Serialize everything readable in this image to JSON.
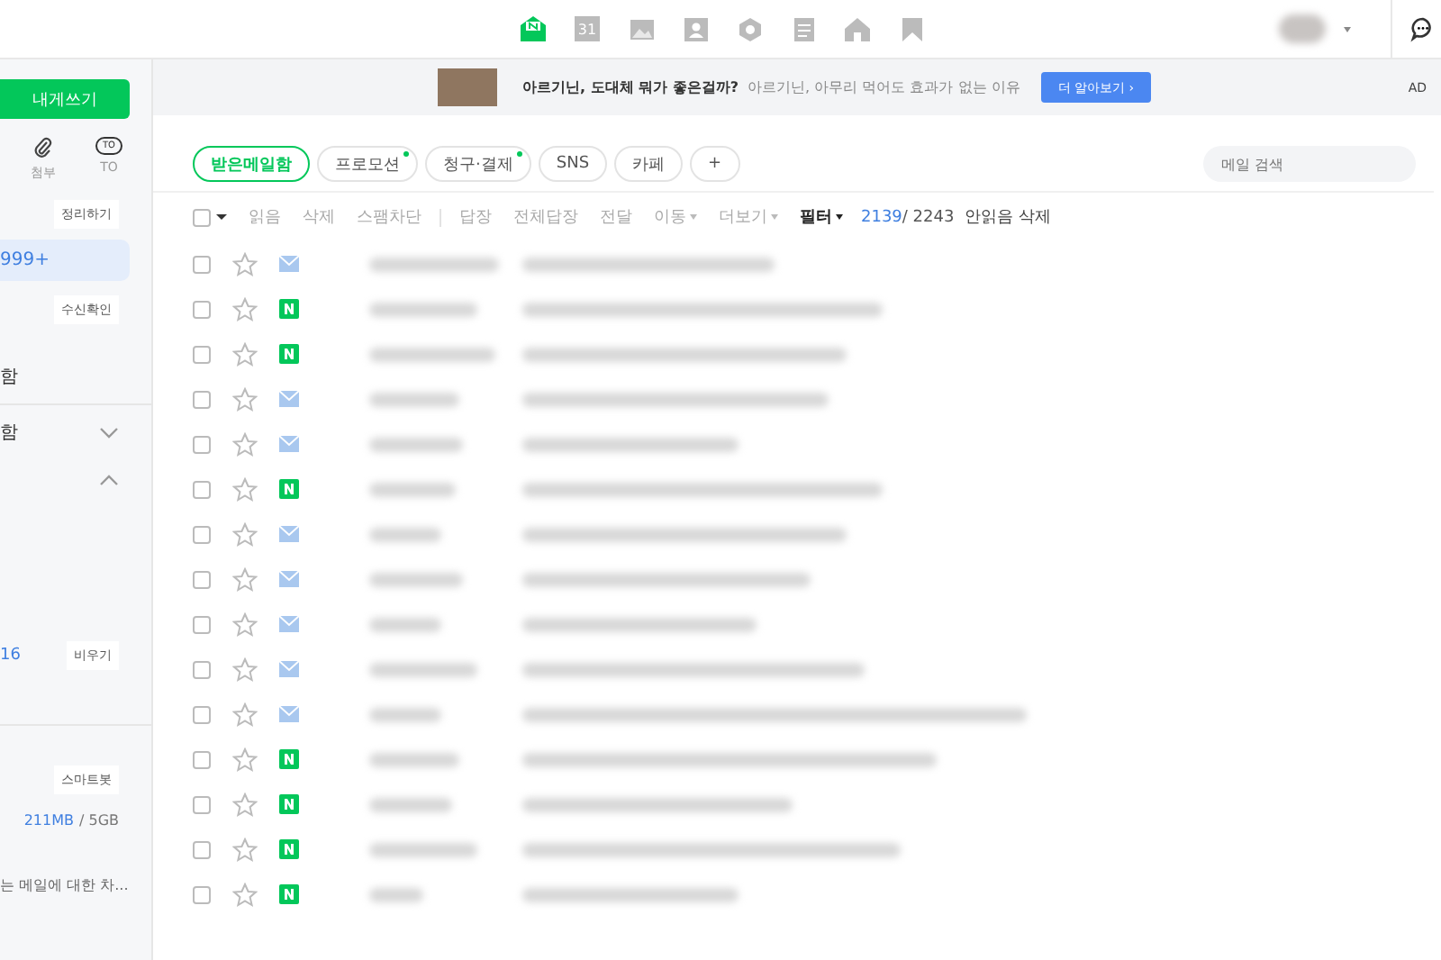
{
  "top_apps": [
    {
      "kind": "mail",
      "selected": true
    },
    {
      "kind": "calendar",
      "selected": false
    },
    {
      "kind": "photo",
      "selected": false
    },
    {
      "kind": "contacts",
      "selected": false
    },
    {
      "kind": "hex",
      "selected": false
    },
    {
      "kind": "memo",
      "selected": false
    },
    {
      "kind": "home",
      "selected": false
    },
    {
      "kind": "bookmark",
      "selected": false
    }
  ],
  "calendar_day": "31",
  "ad": {
    "headline": "아르기닌, 도대체 뭐가 좋은걸까?",
    "text": "아르기닌, 아무리 먹어도 효과가 없는 이유",
    "button": "더 알아보기 ›",
    "badge": "AD"
  },
  "sidebar": {
    "compose": "내게쓰기",
    "attach": "첨부",
    "to_badge": "TO",
    "to_label": "TO",
    "organize": "정리하기",
    "inbox_count": "999+",
    "read_check": "수신확인",
    "folder_a": "함",
    "folder_b": "함",
    "folder_b_expanded": false,
    "folder_c_expanded": true,
    "trash_count": "16",
    "empty": "비우기",
    "smartbot": "스마트봇",
    "used": "211MB",
    "total": "/ 5GB",
    "notice": "는 메일에 대한 차..."
  },
  "tabs": [
    {
      "label": "받은메일함",
      "selected": true,
      "dot": false
    },
    {
      "label": "프로모션",
      "selected": false,
      "dot": true
    },
    {
      "label": "청구·결제",
      "selected": false,
      "dot": true
    },
    {
      "label": "SNS",
      "selected": false,
      "dot": false
    },
    {
      "label": "카페",
      "selected": false,
      "dot": false
    },
    {
      "label": "+",
      "selected": false,
      "dot": false
    }
  ],
  "search": {
    "placeholder": "메일 검색"
  },
  "select_all_checked": false,
  "toolbar": [
    {
      "label": "읽음",
      "kind": "plain"
    },
    {
      "label": "삭제",
      "kind": "plain"
    },
    {
      "label": "스팸차단",
      "kind": "plain"
    },
    {
      "label": "답장",
      "kind": "sep"
    },
    {
      "label": "전체답장",
      "kind": "plain"
    },
    {
      "label": "전달",
      "kind": "plain"
    },
    {
      "label": "이동",
      "kind": "menu"
    },
    {
      "label": "더보기",
      "kind": "menu"
    },
    {
      "label": "필터",
      "kind": "strong"
    }
  ],
  "count": {
    "unread": "2139",
    "total": "/ 2243",
    "action": "안읽음 삭제"
  },
  "rows": [
    {
      "kind": "mail",
      "checked": false,
      "starred": false
    },
    {
      "kind": "n",
      "checked": false,
      "starred": false
    },
    {
      "kind": "n",
      "checked": false,
      "starred": false
    },
    {
      "kind": "mail",
      "checked": false,
      "starred": false
    },
    {
      "kind": "mail",
      "checked": false,
      "starred": false
    },
    {
      "kind": "n",
      "checked": false,
      "starred": false
    },
    {
      "kind": "mail",
      "checked": false,
      "starred": false
    },
    {
      "kind": "mail",
      "checked": false,
      "starred": false
    },
    {
      "kind": "mail",
      "checked": false,
      "starred": false
    },
    {
      "kind": "mail",
      "checked": false,
      "starred": false
    },
    {
      "kind": "mail",
      "checked": false,
      "starred": false
    },
    {
      "kind": "n",
      "checked": false,
      "starred": false
    },
    {
      "kind": "n",
      "checked": false,
      "starred": false
    },
    {
      "kind": "n",
      "checked": false,
      "starred": false
    },
    {
      "kind": "n",
      "checked": false,
      "starred": false
    }
  ]
}
